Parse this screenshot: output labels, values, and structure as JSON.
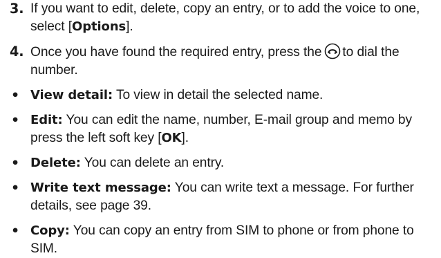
{
  "steps": [
    {
      "number": "3.",
      "text_before": "If you want to edit, delete, copy an entry, or to add the voice to one, select [",
      "bold": "Options",
      "text_after": "]."
    },
    {
      "number": "4.",
      "text_before": "Once you have found the required entry, press the",
      "icon": "send-call-icon",
      "text_after": "to dial the number."
    }
  ],
  "bullets": [
    {
      "marker": "•",
      "term": "View detail:",
      "text": "To view in detail the selected name."
    },
    {
      "marker": "•",
      "term": "Edit:",
      "text": "You can edit the name, number, E-mail group and memo by press the left soft key [",
      "bold": "OK",
      "text_after": "]."
    },
    {
      "marker": "•",
      "term": "Delete:",
      "text": "You can delete an entry."
    },
    {
      "marker": "•",
      "term": "Write text message:",
      "text": "You can write text a message. For further details, see page 39."
    },
    {
      "marker": "•",
      "term": "Copy:",
      "text": "You can copy an entry from SIM to phone or from phone to SIM."
    }
  ]
}
